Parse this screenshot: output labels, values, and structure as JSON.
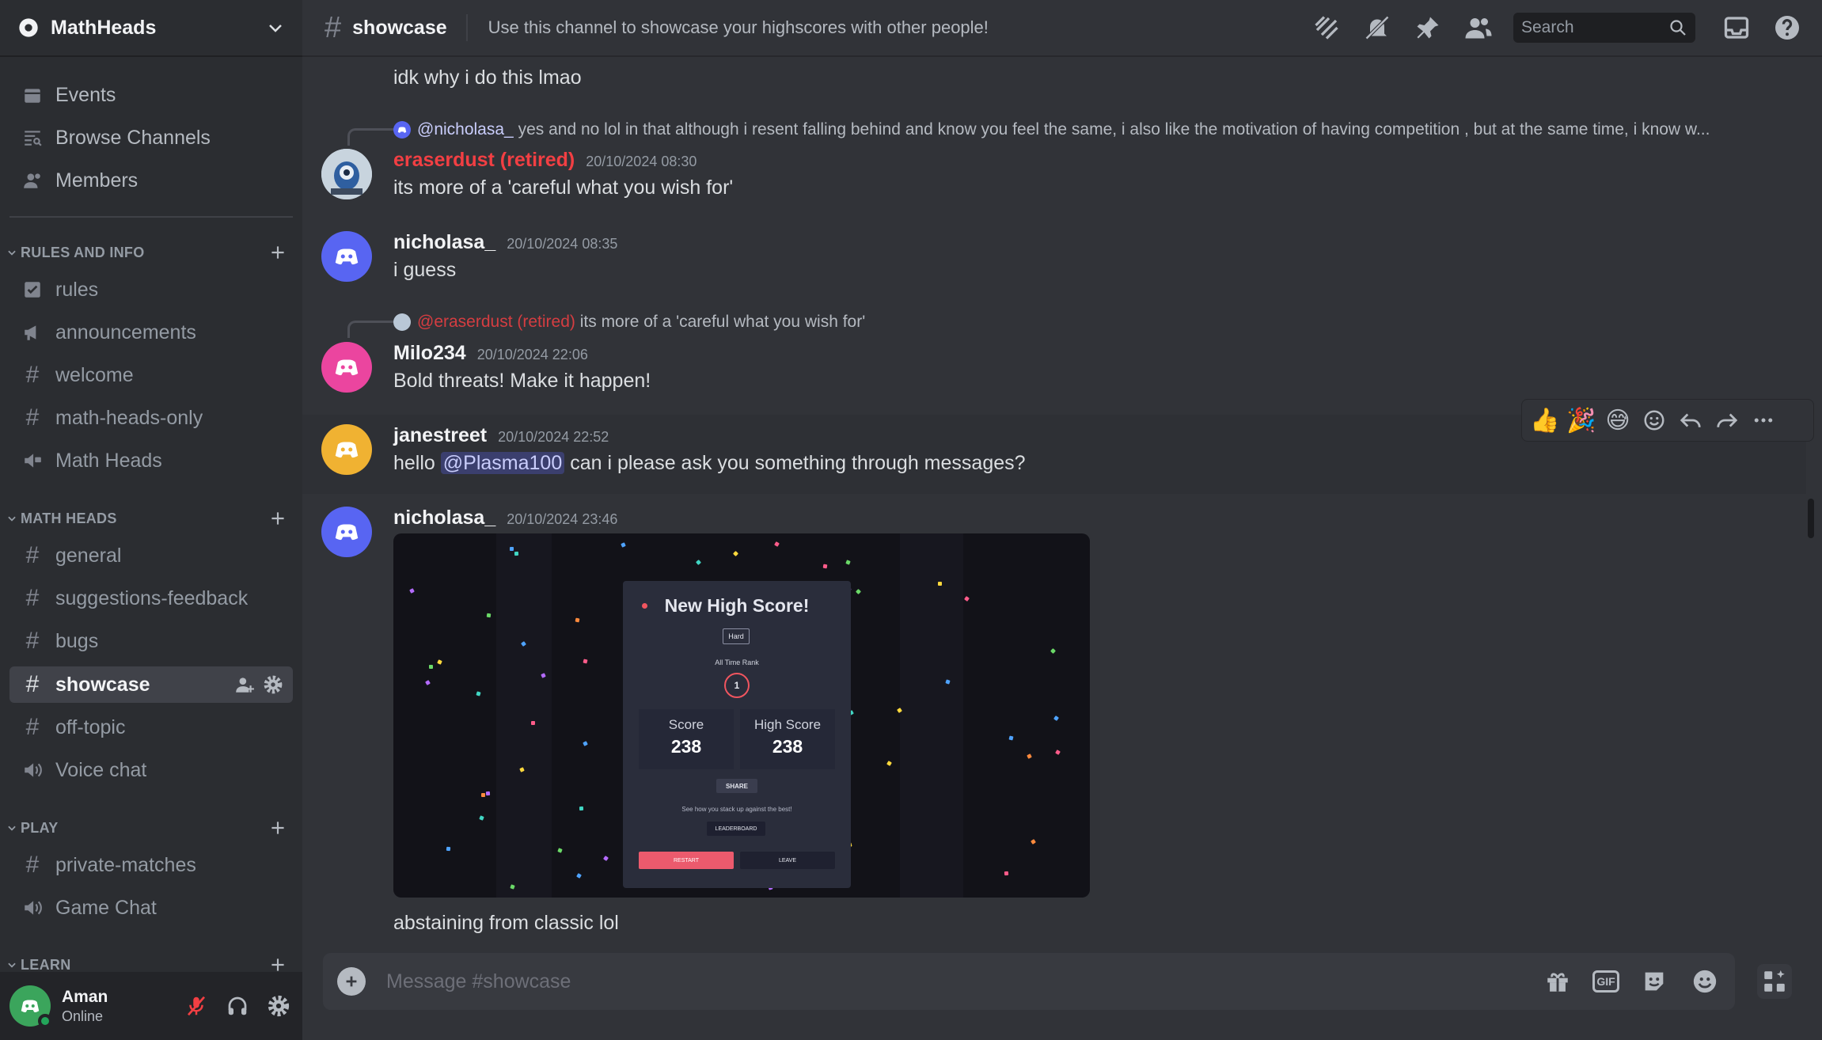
{
  "server": {
    "name": "MathHeads"
  },
  "sidebar": {
    "top_items": [
      {
        "label": "Events",
        "icon": "calendar-icon"
      },
      {
        "label": "Browse Channels",
        "icon": "browse-channels-icon"
      },
      {
        "label": "Members",
        "icon": "members-icon"
      }
    ],
    "categories": [
      {
        "name": "RULES AND INFO",
        "channels": [
          {
            "label": "rules",
            "icon": "rules-icon"
          },
          {
            "label": "announcements",
            "icon": "megaphone-icon"
          },
          {
            "label": "welcome",
            "icon": "hash-icon"
          },
          {
            "label": "math-heads-only",
            "icon": "locked-hash-icon"
          },
          {
            "label": "Math Heads",
            "icon": "locked-voice-icon"
          }
        ]
      },
      {
        "name": "MATH HEADS",
        "channels": [
          {
            "label": "general",
            "icon": "hash-icon"
          },
          {
            "label": "suggestions-feedback",
            "icon": "hash-icon"
          },
          {
            "label": "bugs",
            "icon": "hash-icon"
          },
          {
            "label": "showcase",
            "icon": "hash-icon",
            "active": true
          },
          {
            "label": "off-topic",
            "icon": "hash-icon"
          },
          {
            "label": "Voice chat",
            "icon": "speaker-icon"
          }
        ]
      },
      {
        "name": "PLAY",
        "channels": [
          {
            "label": "private-matches",
            "icon": "hash-icon"
          },
          {
            "label": "Game Chat",
            "icon": "speaker-icon"
          }
        ]
      },
      {
        "name": "LEARN",
        "channels": []
      }
    ]
  },
  "user": {
    "name": "Aman",
    "status": "Online"
  },
  "header": {
    "channel_name": "showcase",
    "topic": "Use this channel to showcase your highscores with other people!",
    "search_placeholder": "Search"
  },
  "messages": [
    {
      "text": "idk why i do this lmao"
    },
    {
      "reply": {
        "author": "@nicholasa_",
        "text": "yes and no lol in that although i resent falling behind and know you feel the same, i also like the motivation of having competition , but at the same time, i know w..."
      },
      "author": "eraserdust (retired)",
      "author_color": "#f23f43",
      "time": "20/10/2024 08:30",
      "text": "its more of a 'careful what you wish for'"
    },
    {
      "author": "nicholasa_",
      "time": "20/10/2024 08:35",
      "text": "i guess",
      "avatar_color": "#5865f2"
    },
    {
      "reply": {
        "author": "@eraserdust (retired)",
        "text": "its more of a 'careful what you wish for'"
      },
      "author": "Milo234",
      "time": "20/10/2024 22:06",
      "text": "Bold threats! Make it happen!",
      "avatar_color": "#eb459f"
    },
    {
      "author": "janestreet",
      "time": "20/10/2024 22:52",
      "text_before": "hello",
      "mention": "@Plasma100",
      "text_after": "can i please ask you something through messages?",
      "avatar_color": "#f0b232"
    },
    {
      "author": "nicholasa_",
      "time": "20/10/2024 23:46",
      "text": "abstaining from classic lol",
      "avatar_color": "#5865f2"
    }
  ],
  "reactions": [
    "👍",
    "🎉",
    "😅"
  ],
  "embed_image": {
    "title": "New High Score!",
    "difficulty": "Hard",
    "rank_label": "All Time Rank",
    "rank": "1",
    "score_label": "Score",
    "score": "238",
    "high_score_label": "High Score",
    "high_score": "238",
    "share": "SHARE",
    "note": "See how you stack up against the best!",
    "leaderboard": "LEADERBOARD",
    "restart": "RESTART",
    "leave": "LEAVE"
  },
  "composer": {
    "placeholder": "Message #showcase",
    "gif_label": "GIF"
  },
  "colors": {
    "accent": "#5865f2",
    "online": "#23a55a",
    "danger": "#f23f43",
    "sidebar_bg": "#2b2d31",
    "chat_bg": "#313338"
  }
}
